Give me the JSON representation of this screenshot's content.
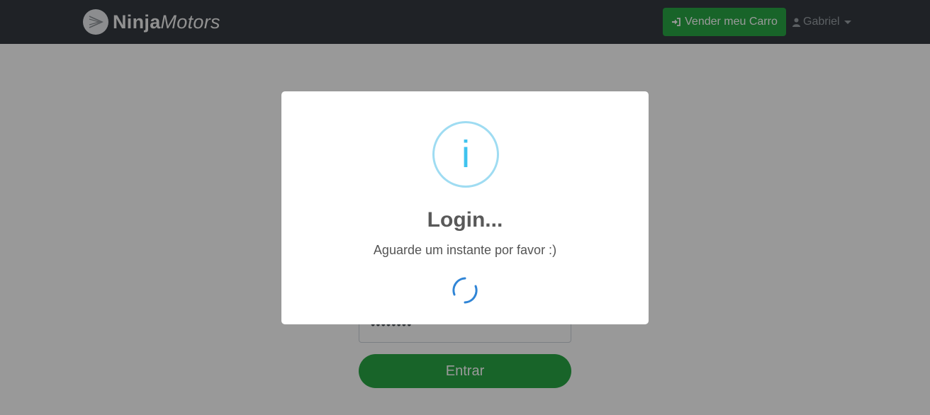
{
  "navbar": {
    "brand_bold": "Ninja",
    "brand_italic": "Motors",
    "sell_button_label": "Vender meu Carro",
    "sell_icon": "sign-in-icon",
    "user_name": "Gabriel",
    "user_icon": "user-icon"
  },
  "login_form": {
    "password_value": "••••••••",
    "submit_label": "Entrar"
  },
  "modal": {
    "icon": "info-icon",
    "icon_glyph": "i",
    "title": "Login...",
    "text": "Aguarde um instante por favor :)",
    "loading": "spinner-icon"
  },
  "colors": {
    "navbar_bg": "#343a40",
    "success": "#28a745",
    "info_icon": "#3fc3ee",
    "spinner": "#3085d6"
  }
}
